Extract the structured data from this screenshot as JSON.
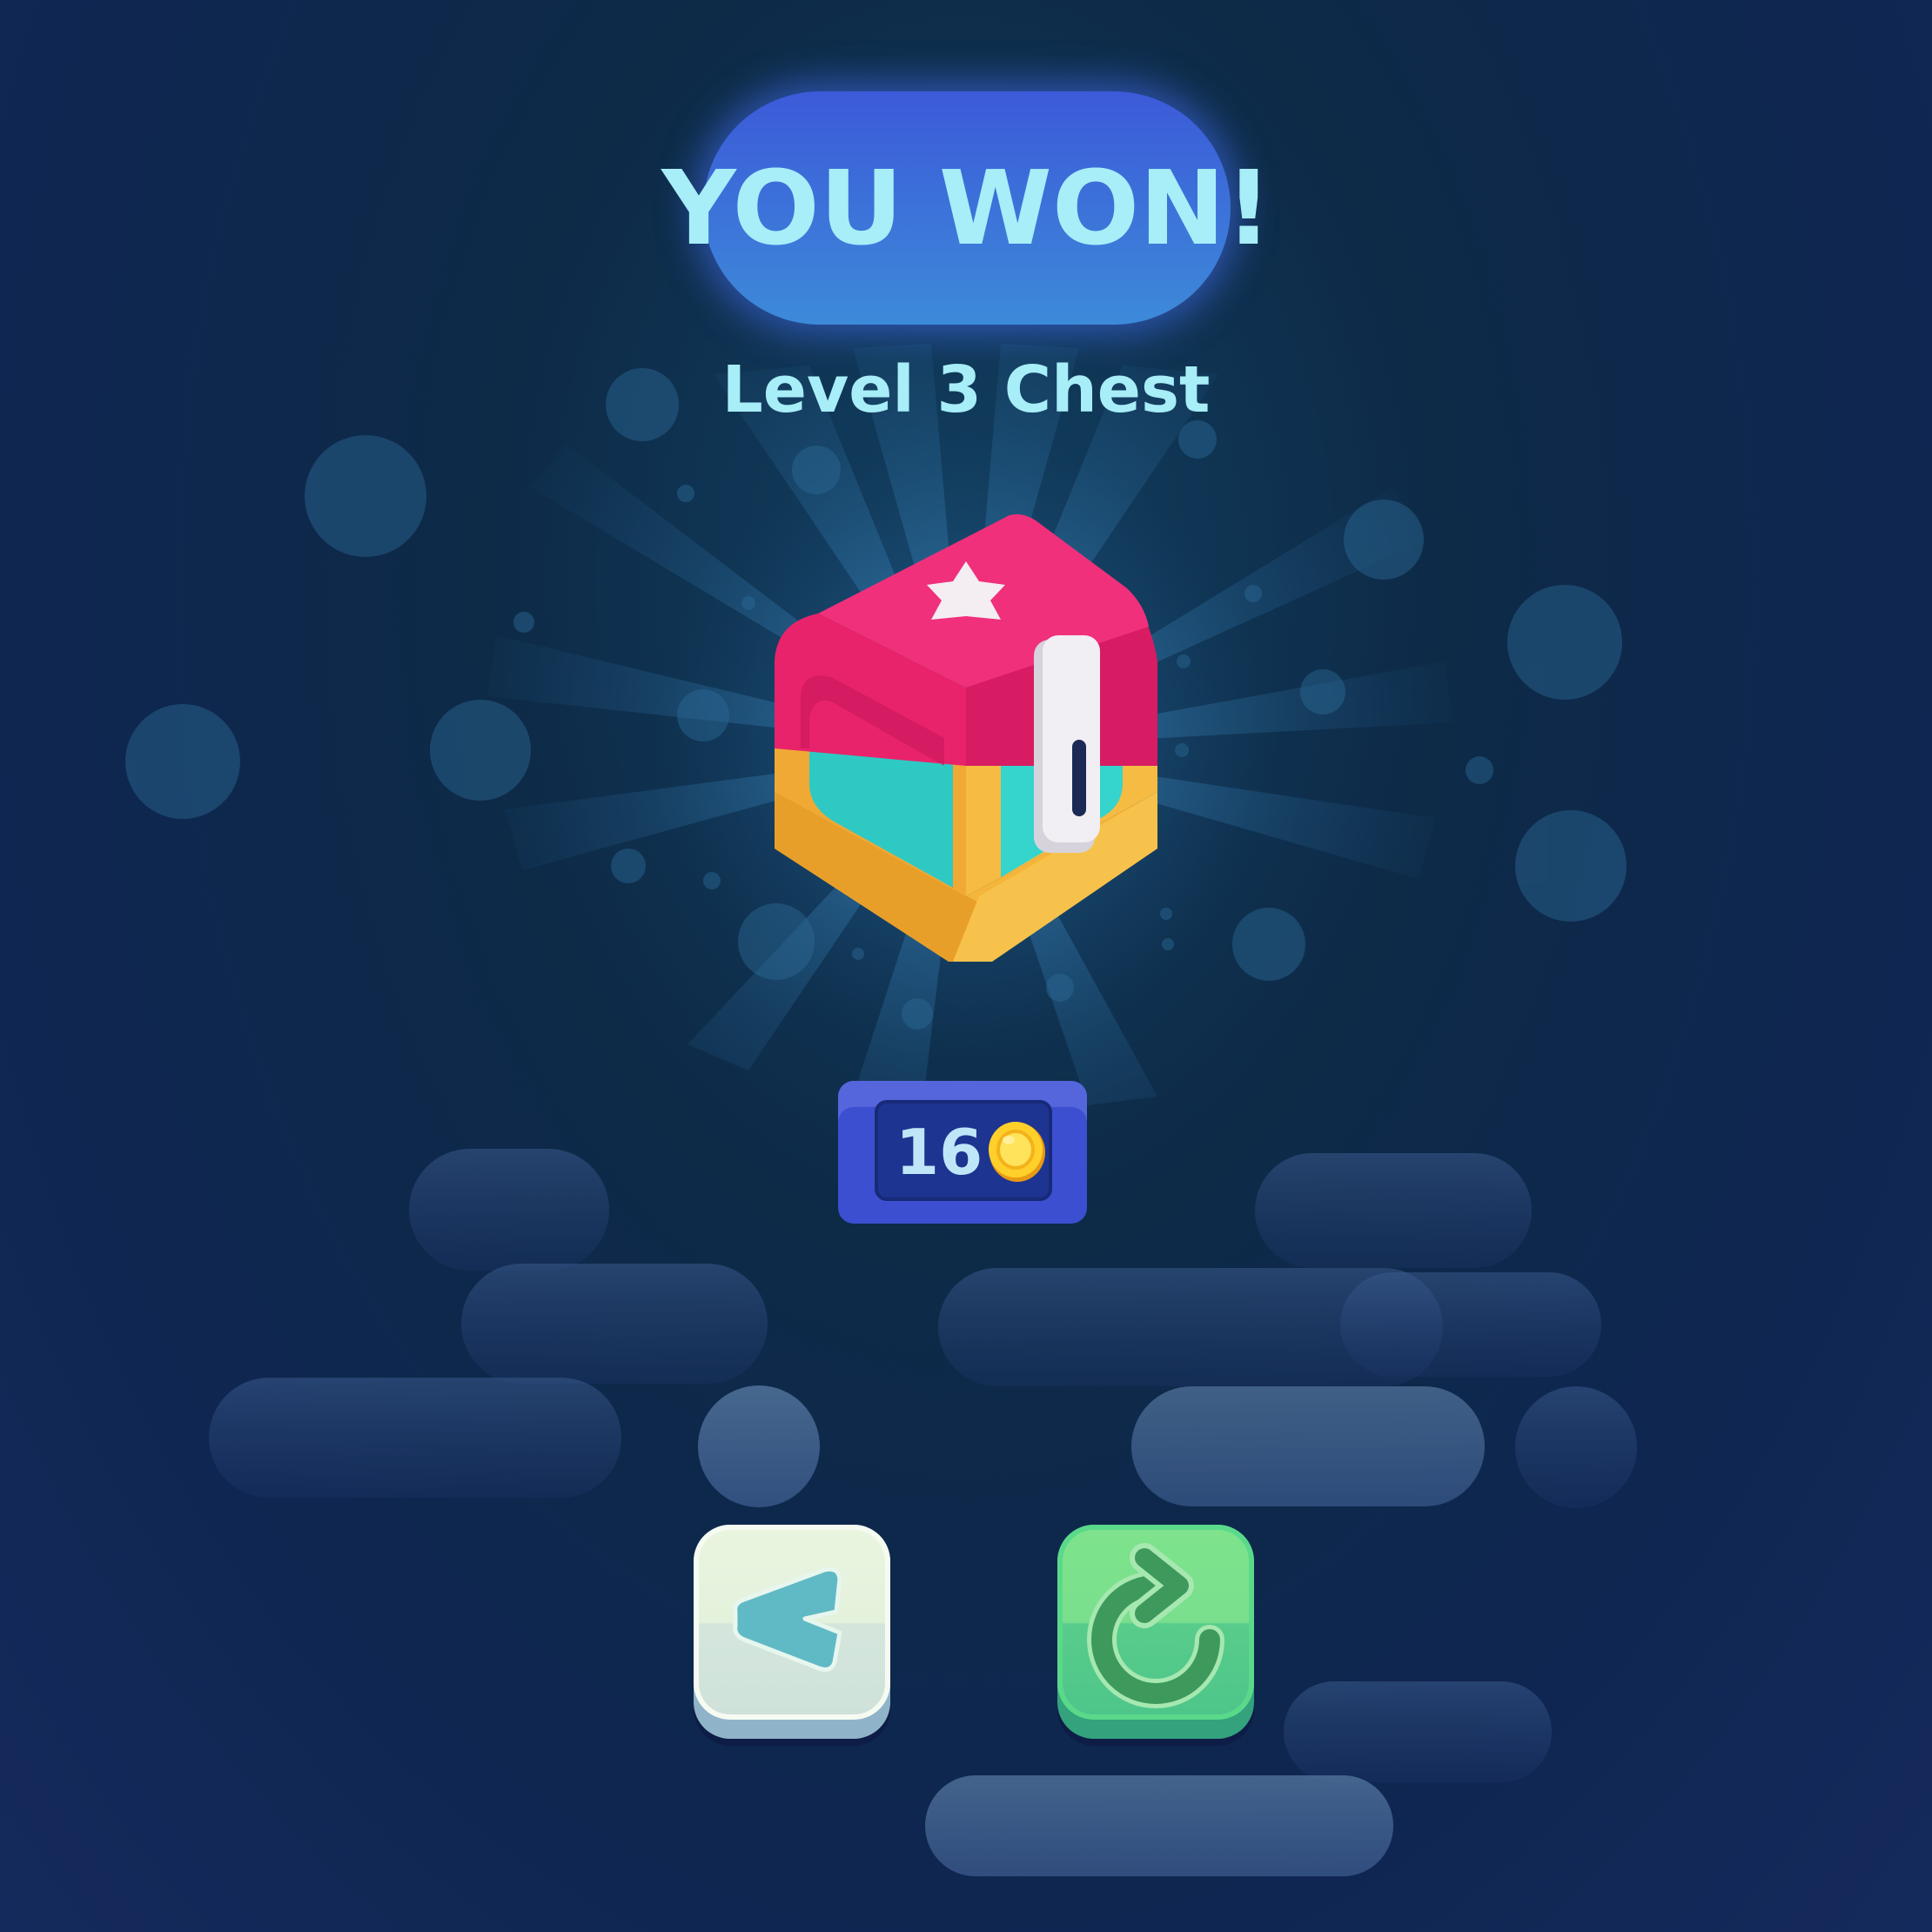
{
  "result": {
    "title": "YOU WON!",
    "subtitle": "Level 3 Chest"
  },
  "reward": {
    "amount": "16",
    "icon": "coin-icon"
  },
  "buttons": {
    "back": {
      "icon": "back-arrow-icon"
    },
    "replay": {
      "icon": "replay-icon"
    }
  },
  "colors": {
    "title_pill": "#3c5ad9",
    "title_text": "#a7eef8",
    "chest_lid": "#e8236b",
    "chest_base": "#f4b53a",
    "chest_glass": "#2fc9c3",
    "reward_panel": "#3b4fd0",
    "back_button": "#e6f3de",
    "replay_button": "#72dd8c"
  }
}
